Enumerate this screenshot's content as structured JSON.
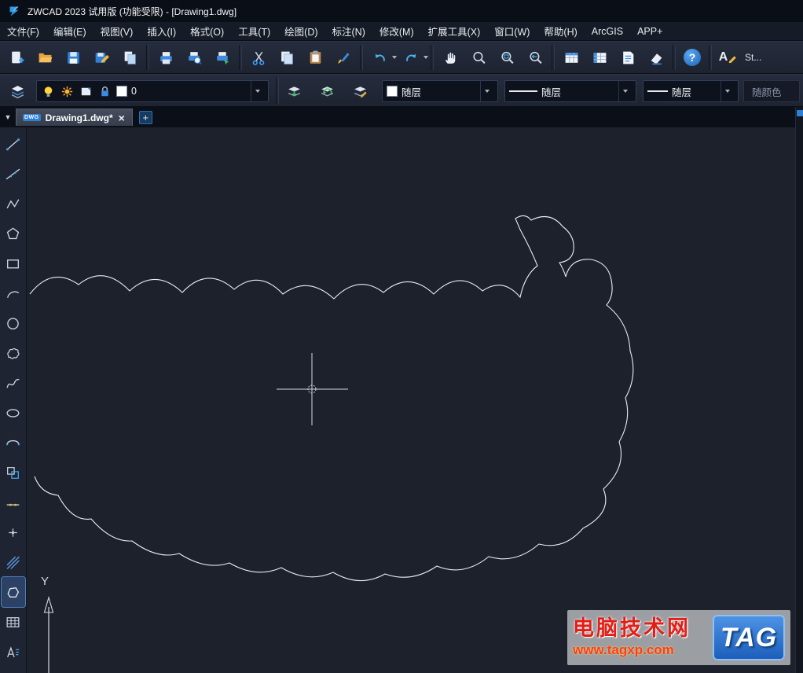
{
  "title_bar": {
    "title": "ZWCAD 2023 试用版 (功能受限) - [Drawing1.dwg]"
  },
  "menu_bar": {
    "items": [
      {
        "name": "file",
        "label": "文件(F)"
      },
      {
        "name": "edit",
        "label": "编辑(E)"
      },
      {
        "name": "view",
        "label": "视图(V)"
      },
      {
        "name": "insert",
        "label": "插入(I)"
      },
      {
        "name": "format",
        "label": "格式(O)"
      },
      {
        "name": "tools",
        "label": "工具(T)"
      },
      {
        "name": "draw",
        "label": "绘图(D)"
      },
      {
        "name": "dimension",
        "label": "标注(N)"
      },
      {
        "name": "modify",
        "label": "修改(M)"
      },
      {
        "name": "express-tools",
        "label": "扩展工具(X)"
      },
      {
        "name": "window",
        "label": "窗口(W)"
      },
      {
        "name": "help",
        "label": "帮助(H)"
      },
      {
        "name": "arcgis",
        "label": "ArcGIS"
      },
      {
        "name": "app-plus",
        "label": "APP+"
      }
    ]
  },
  "standard_toolbar": {
    "tools": [
      "new",
      "open",
      "save",
      "save-as",
      "export",
      "plot",
      "plot-preview",
      "publish",
      "cut",
      "copy",
      "paste",
      "match-properties",
      "undo",
      "redo",
      "pan",
      "zoom-realtime",
      "zoom-window",
      "zoom-previous",
      "table",
      "spreadsheet",
      "text-document",
      "erase",
      "help",
      "text-style"
    ],
    "help_glyph": "?",
    "text_style_glyph": "A",
    "text_style_label": "St..."
  },
  "properties_toolbar": {
    "icons": [
      "layer-manager-icon",
      "bulb-icon",
      "freeze-icon",
      "plot-icon",
      "lock-icon",
      "color-swatch-icon",
      "layer-make-current-icon",
      "layer-previous-icon",
      "layer-match-icon"
    ],
    "layer": {
      "value": "0"
    },
    "color": {
      "value": "随层"
    },
    "linetype": {
      "value": "随层"
    },
    "lineweight": {
      "value": "随层"
    },
    "plot_style": {
      "value": "随颜色"
    }
  },
  "tab_bar": {
    "dropdown_icon": "▼",
    "active_tab": {
      "label": "Drawing1.dwg*",
      "badge": "DWG",
      "close_glyph": "×"
    },
    "new_tab_glyph": "+"
  },
  "draw_toolbar": {
    "tools": [
      "line",
      "construction-line",
      "polyline",
      "polygon",
      "rectangle",
      "arc",
      "circle",
      "revision-cloud",
      "spline",
      "ellipse",
      "ellipse-arc",
      "insert-block",
      "divide",
      "point",
      "hatch",
      "wipeout",
      "table",
      "mtext"
    ],
    "active_tool": "wipeout"
  },
  "canvas": {
    "ucs_y_label": "Y",
    "drawing_entity": "revision-cloud-sheep-outline"
  },
  "watermark": {
    "title": "电脑技术网",
    "url": "www.tagxp.com",
    "badge": "TAG"
  },
  "colors": {
    "accent_blue": "#2f7fd6",
    "toolbar_bg": "#1f2532",
    "canvas_bg": "#1c212c",
    "entity_stroke": "#e9ecf1",
    "watermark_red": "#e31e17",
    "badge_blue": "#2468c8"
  }
}
